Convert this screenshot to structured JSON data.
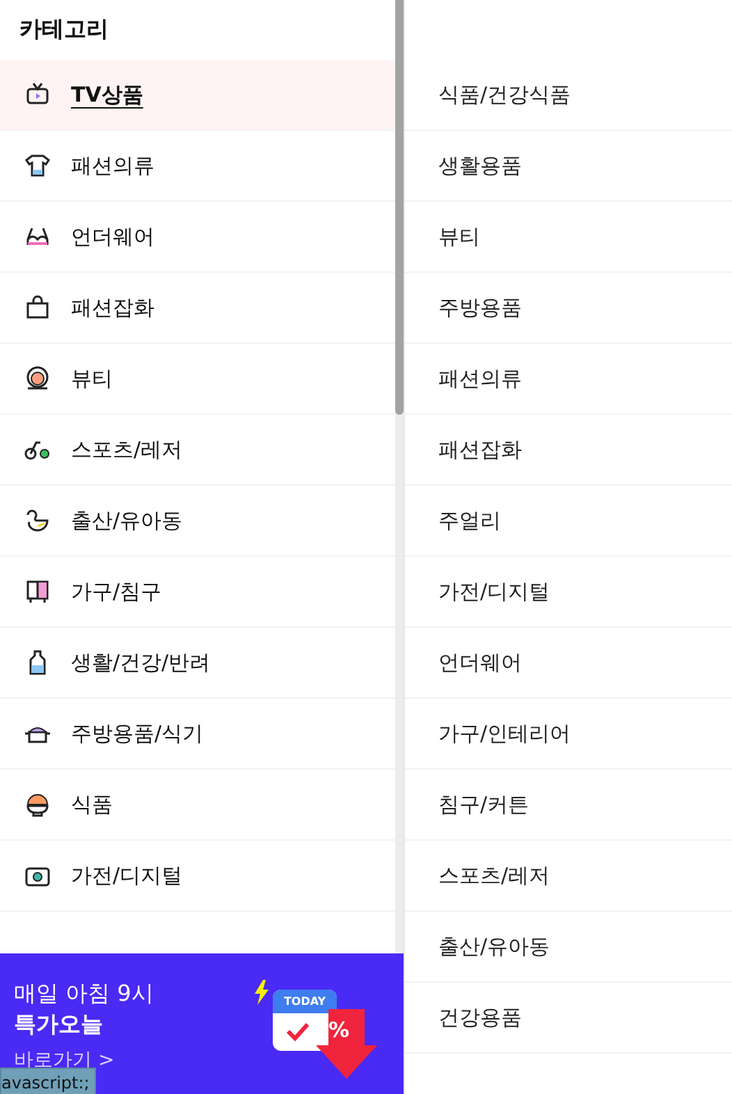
{
  "header": {
    "title": "카테고리"
  },
  "categories": [
    {
      "label": "TV상품",
      "selected": true
    },
    {
      "label": "패션의류",
      "selected": false
    },
    {
      "label": "언더웨어",
      "selected": false
    },
    {
      "label": "패션잡화",
      "selected": false
    },
    {
      "label": "뷰티",
      "selected": false
    },
    {
      "label": "스포츠/레저",
      "selected": false
    },
    {
      "label": "출산/유아동",
      "selected": false
    },
    {
      "label": "가구/침구",
      "selected": false
    },
    {
      "label": "생활/건강/반려",
      "selected": false
    },
    {
      "label": "주방용품/식기",
      "selected": false
    },
    {
      "label": "식품",
      "selected": false
    },
    {
      "label": "가전/디지털",
      "selected": false
    }
  ],
  "subcategories": [
    "식품/건강식품",
    "생활용품",
    "뷰티",
    "주방용품",
    "패션의류",
    "패션잡화",
    "주얼리",
    "가전/디지털",
    "언더웨어",
    "가구/인테리어",
    "침구/커튼",
    "스포츠/레저",
    "출산/유아동",
    "건강용품"
  ],
  "banner": {
    "line_1": "매일 아침 9시",
    "line_2": "특가오늘",
    "link": "바로가기 >",
    "calendar_label": "TODAY",
    "discount_mark": "%"
  },
  "status_bar": {
    "url": "avascript:;"
  }
}
